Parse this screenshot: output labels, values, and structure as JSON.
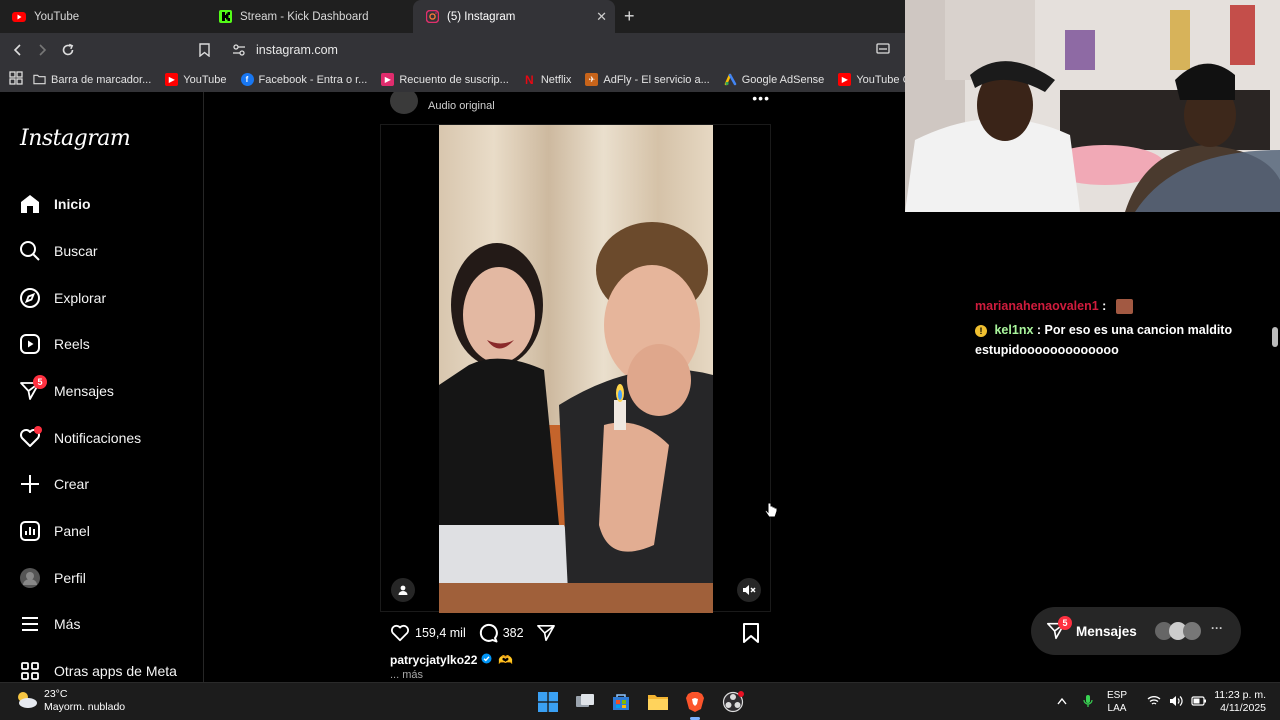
{
  "browser": {
    "tabs": [
      {
        "title": "YouTube",
        "icon": "youtube-icon",
        "active": false
      },
      {
        "title": "Stream - Kick Dashboard",
        "icon": "kick-icon",
        "active": false
      },
      {
        "title": "(5) Instagram",
        "icon": "instagram-icon",
        "active": true
      }
    ],
    "url": "instagram.com",
    "bookmarks": [
      {
        "label": "Barra de marcador...",
        "icon": "folder-icon"
      },
      {
        "label": "YouTube",
        "icon": "youtube-icon"
      },
      {
        "label": "Facebook - Entra o r...",
        "icon": "facebook-icon"
      },
      {
        "label": "Recuento de suscrip...",
        "icon": "counter-icon"
      },
      {
        "label": "Netflix",
        "icon": "netflix-icon"
      },
      {
        "label": "AdFly - El servicio a...",
        "icon": "adfly-icon"
      },
      {
        "label": "Google AdSense",
        "icon": "adsense-icon"
      },
      {
        "label": "YouTube Creator St...",
        "icon": "youtube-icon"
      }
    ]
  },
  "instagram": {
    "logo": "Instagram",
    "nav": [
      {
        "label": "Inicio",
        "icon": "home-icon",
        "active": true
      },
      {
        "label": "Buscar",
        "icon": "search-icon"
      },
      {
        "label": "Explorar",
        "icon": "compass-icon"
      },
      {
        "label": "Reels",
        "icon": "reels-icon"
      },
      {
        "label": "Mensajes",
        "icon": "messenger-icon",
        "badge": "5"
      },
      {
        "label": "Notificaciones",
        "icon": "heart-icon"
      },
      {
        "label": "Crear",
        "icon": "plus-icon"
      },
      {
        "label": "Panel",
        "icon": "dashboard-icon"
      },
      {
        "label": "Perfil",
        "icon": "profile-avatar"
      },
      {
        "label": "Más",
        "icon": "menu-icon"
      },
      {
        "label": "Otras apps de Meta",
        "icon": "meta-apps-icon"
      }
    ],
    "post": {
      "audio": "Audio original",
      "likes": "159,4 mil",
      "comments": "382",
      "username": "patrycjatylko22",
      "more": "... más"
    },
    "messages_pill": {
      "label": "Mensajes",
      "badge": "5"
    }
  },
  "chat": [
    {
      "user": "marianahenaovalen1",
      "separator": ":",
      "text": ""
    },
    {
      "user": "kel1nx",
      "separator": ":",
      "text": "Por eso es una cancion maldito estupidooooooooooooo"
    }
  ],
  "taskbar": {
    "temperature": "23°C",
    "weather": "Mayorm. nublado",
    "lang1": "ESP",
    "lang2": "LAA",
    "time": "11:23 p. m.",
    "date": "4/11/2025"
  }
}
